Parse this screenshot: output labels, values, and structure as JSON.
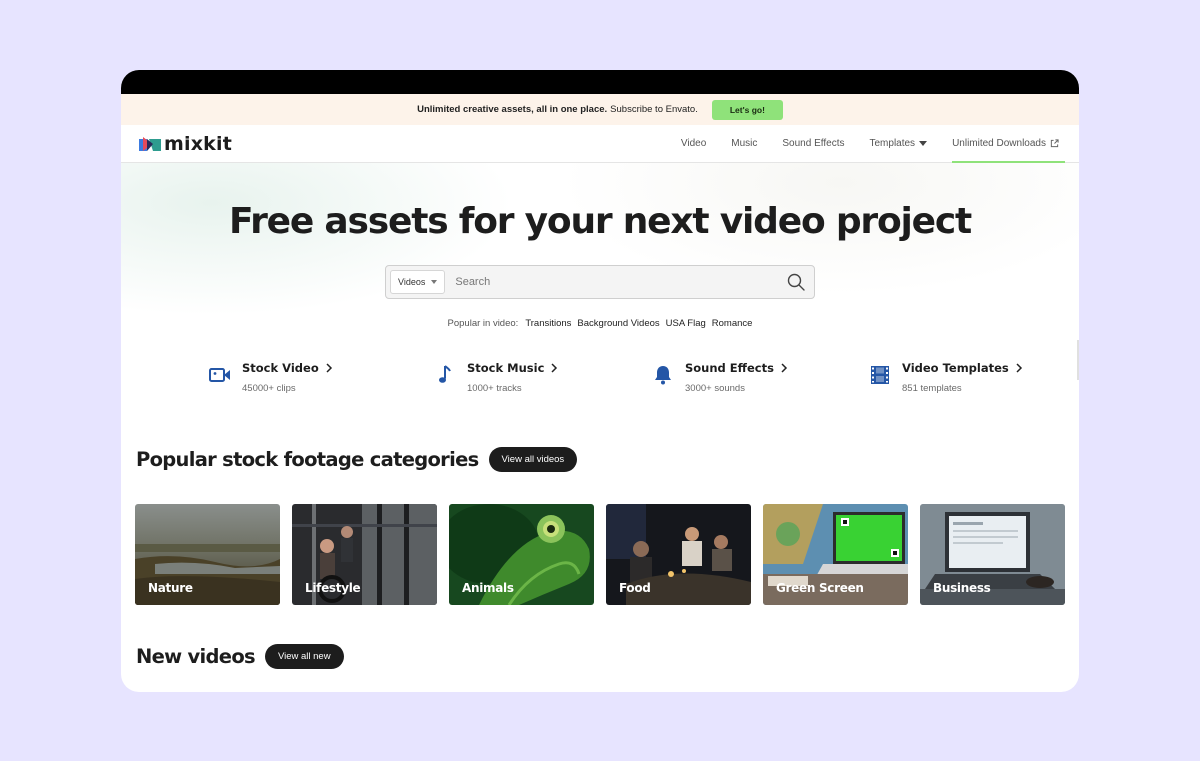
{
  "promo": {
    "headline": "Unlimited creative assets, all in one place.",
    "sub": "Subscribe to Envato.",
    "cta": "Let's go!"
  },
  "brand": {
    "name": "mixkit"
  },
  "nav": {
    "items": [
      {
        "label": "Video"
      },
      {
        "label": "Music"
      },
      {
        "label": "Sound Effects"
      },
      {
        "label": "Templates"
      },
      {
        "label": "Unlimited Downloads"
      }
    ]
  },
  "hero": {
    "title": "Free assets for your next video project",
    "search": {
      "type": "Videos",
      "placeholder": "Search"
    },
    "popular": {
      "label": "Popular in video:",
      "tags": [
        "Transitions",
        "Background Videos",
        "USA Flag",
        "Romance"
      ]
    }
  },
  "features": [
    {
      "name": "Stock Video",
      "count": "45000+ clips",
      "icon": "video-camera-icon"
    },
    {
      "name": "Stock Music",
      "count": "1000+ tracks",
      "icon": "music-note-icon"
    },
    {
      "name": "Sound Effects",
      "count": "3000+ sounds",
      "icon": "bell-icon"
    },
    {
      "name": "Video Templates",
      "count": "851 templates",
      "icon": "film-strip-icon"
    }
  ],
  "categories": {
    "title": "Popular stock footage categories",
    "button": "View all videos",
    "items": [
      {
        "label": "Nature"
      },
      {
        "label": "Lifestyle"
      },
      {
        "label": "Animals"
      },
      {
        "label": "Food"
      },
      {
        "label": "Green Screen"
      },
      {
        "label": "Business"
      }
    ]
  },
  "new_videos": {
    "title": "New videos",
    "button": "View all new"
  },
  "colors": {
    "accent": "#8fe27a",
    "icon_blue": "#2456a6",
    "promo_bg": "#fdf3ea",
    "page_bg": "#e7e4ff"
  }
}
